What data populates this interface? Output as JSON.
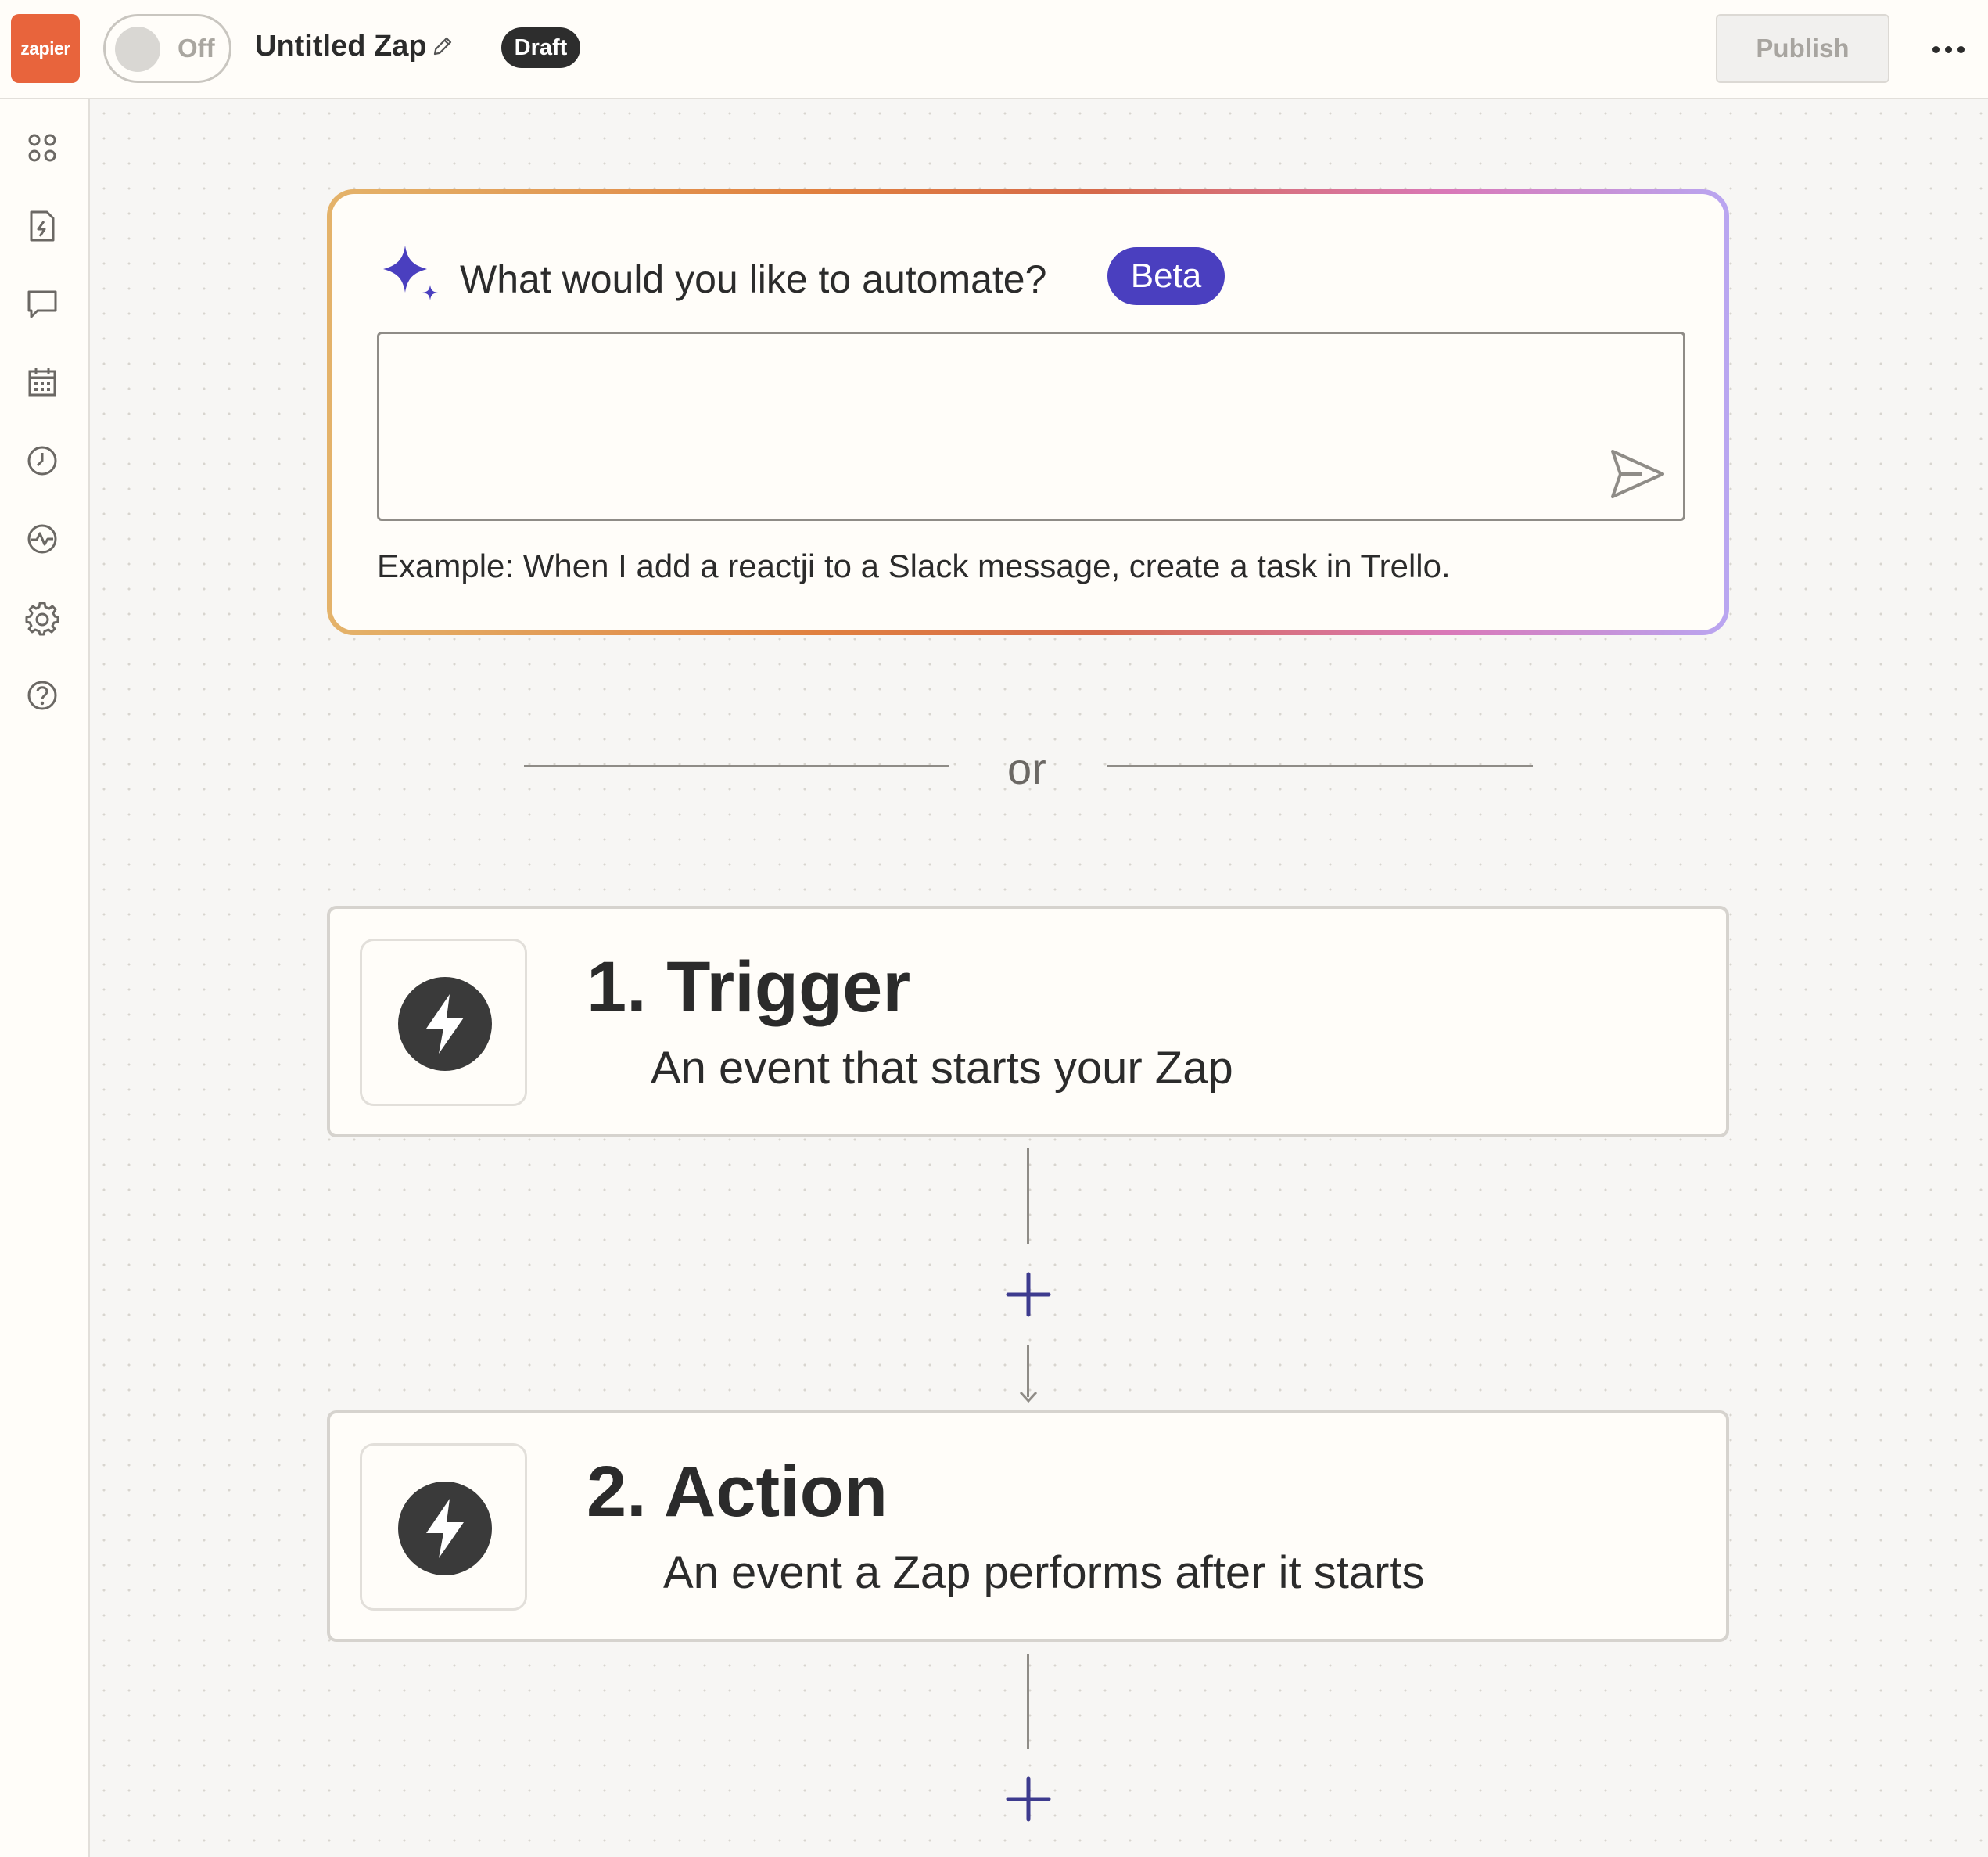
{
  "header": {
    "logo_text": "zapier",
    "toggle_label": "Off",
    "zap_title": "Untitled Zap",
    "status_badge": "Draft",
    "publish_label": "Publish"
  },
  "sidebar": {
    "icons": [
      "apps-icon",
      "zap-file-icon",
      "comment-icon",
      "calendar-icon",
      "history-icon",
      "activity-icon",
      "settings-icon",
      "help-icon"
    ]
  },
  "ai_prompt": {
    "question": "What would you like to automate?",
    "badge": "Beta",
    "input_value": "",
    "example": "Example: When I add a reactji to a Slack message, create a task in Trello."
  },
  "divider": {
    "text": "or"
  },
  "steps": [
    {
      "title": "1. Trigger",
      "description": "An event that starts your Zap"
    },
    {
      "title": "2. Action",
      "description": "An event a Zap performs after it starts"
    }
  ],
  "colors": {
    "brand": "#e8643c",
    "beta_badge": "#4a3fbf",
    "plus": "#3d3b8e",
    "step_icon": "#3a3a3a"
  }
}
